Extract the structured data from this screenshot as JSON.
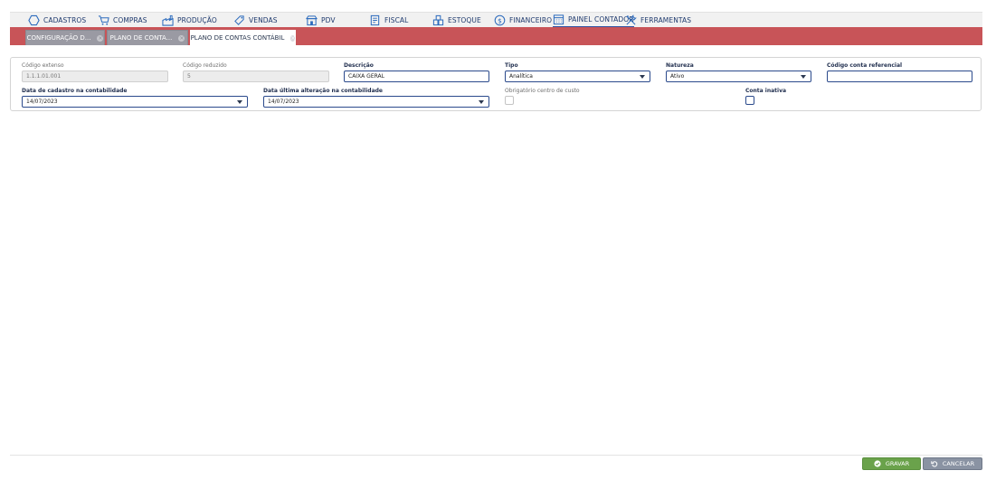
{
  "menu": {
    "items": [
      {
        "label": "CADASTROS",
        "icon": "hexagon-icon"
      },
      {
        "label": "COMPRAS",
        "icon": "cart-icon"
      },
      {
        "label": "PRODUÇÃO",
        "icon": "factory-icon"
      },
      {
        "label": "VENDAS",
        "icon": "tag-icon"
      },
      {
        "label": "PDV",
        "icon": "store-icon"
      },
      {
        "label": "FISCAL",
        "icon": "document-icon"
      },
      {
        "label": "ESTOQUE",
        "icon": "boxes-icon"
      },
      {
        "label": "FINANCEIRO",
        "icon": "dollar-icon"
      },
      {
        "label": "PAINEL CONTADOR",
        "icon": "calculator-icon",
        "active": true
      },
      {
        "label": "FERRAMENTAS",
        "icon": "tools-icon"
      }
    ]
  },
  "tabs": [
    {
      "label": "CONFIGURAÇÃO D...",
      "active": false
    },
    {
      "label": "PLANO DE CONTA...",
      "active": false
    },
    {
      "label": "PLANO DE CONTAS CONTÁBIL",
      "active": true
    }
  ],
  "form": {
    "codigo_extenso": {
      "label": "Código extenso",
      "value": "1.1.1.01.001"
    },
    "codigo_reduzido": {
      "label": "Código reduzido",
      "value": "5"
    },
    "descricao": {
      "label": "Descrição",
      "value": "CAIXA GERAL"
    },
    "tipo": {
      "label": "Tipo",
      "value": "Analítica"
    },
    "natureza": {
      "label": "Natureza",
      "value": "Ativo"
    },
    "codigo_conta_referencial": {
      "label": "Código conta referencial",
      "value": ""
    },
    "data_cadastro": {
      "label": "Data de cadastro na contabilidade",
      "value": "14/07/2023"
    },
    "data_alteracao": {
      "label": "Data última alteração na contabilidade",
      "value": "14/07/2023"
    },
    "obrigatorio_centro_custo": {
      "label": "Obrigatório centro de custo",
      "checked": false
    },
    "conta_inativa": {
      "label": "Conta inativa",
      "checked": false
    }
  },
  "footer": {
    "save_label": "GRAVAR",
    "cancel_label": "CANCELAR"
  },
  "colors": {
    "tabbar": "#c85458",
    "menu_text": "#1f3a6e",
    "save_button": "#6aa24b",
    "cancel_button": "#8a93a3",
    "input_border": "#2b4a8c"
  }
}
